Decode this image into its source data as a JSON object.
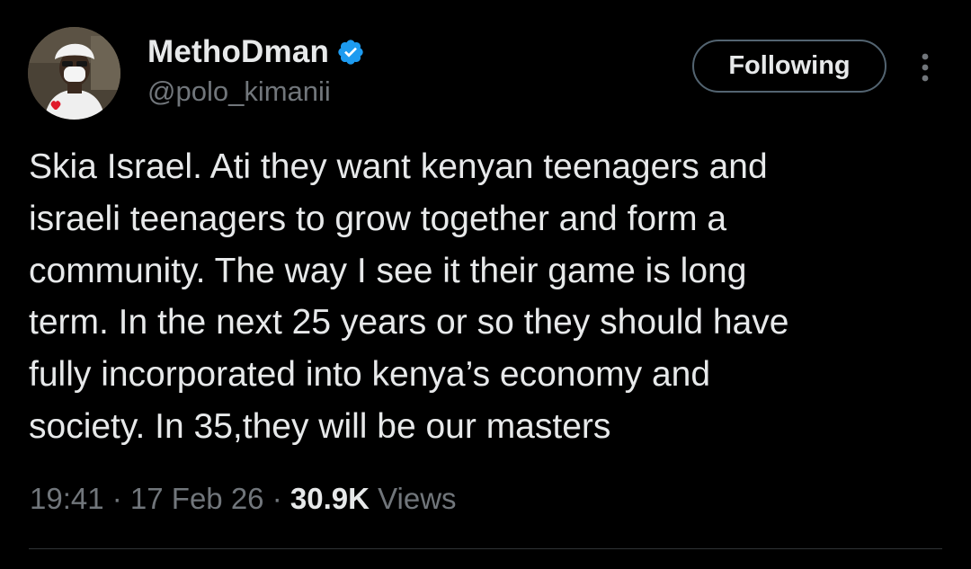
{
  "user": {
    "display_name": "MethoDman",
    "handle": "@polo_kimanii",
    "verified": true,
    "verified_color": "#1d9bf0"
  },
  "actions": {
    "follow_label": "Following",
    "more_icon": "more-vertical-icon"
  },
  "tweet": {
    "text": "Skia Israel. Ati they want kenyan teenagers and\nisraeli teenagers to grow together and form a\ncommunity. The way I see it their game is long\nterm. In the next 25 years or so they should have\nfully incorporated into kenya’s economy and\nsociety. In 35,they will be our masters"
  },
  "meta": {
    "time": "19:41",
    "separator": " · ",
    "date": "17 Feb 26",
    "views_count": "30.9K",
    "views_label": "Views"
  },
  "colors": {
    "background": "#000000",
    "text_primary": "#e7e9ea",
    "text_secondary": "#71767b",
    "border": "#536471",
    "divider": "#2f3336"
  }
}
